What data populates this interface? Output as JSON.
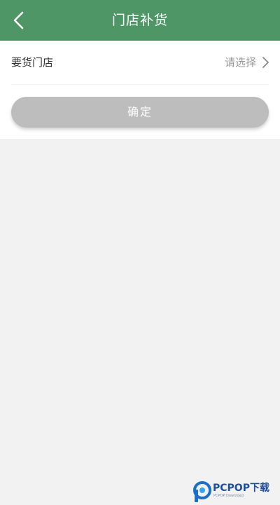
{
  "header": {
    "title": "门店补货",
    "back_icon": "chevron-left-icon",
    "background_color": "#4f9667"
  },
  "form": {
    "store_label": "要货门店",
    "store_placeholder": "请选择",
    "chevron_icon": "chevron-right-icon"
  },
  "actions": {
    "confirm_label": "确定",
    "confirm_color": "#bdbdbd"
  },
  "watermark": {
    "brand": "PCPOP下载",
    "sub": "PCPOP Download"
  }
}
